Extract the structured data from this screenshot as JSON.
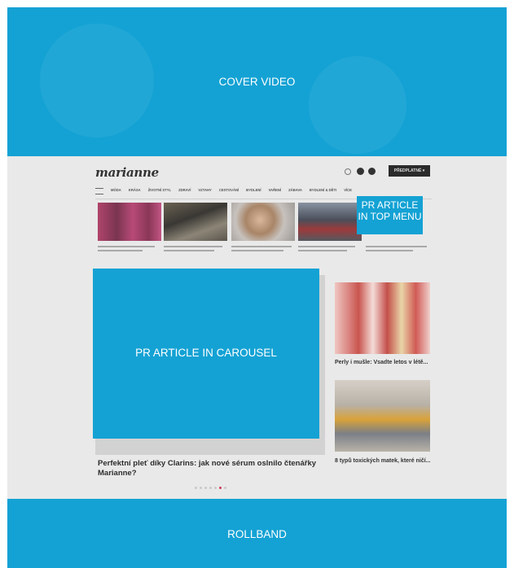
{
  "cover": {
    "label": "COVER VIDEO",
    "color": "#14a2d4"
  },
  "site": {
    "logo": "marianne",
    "subscribe_label": "PŘEDPLATNÉ",
    "nav_items": [
      "MÓDA",
      "KRÁSA",
      "ŽIVOTNÍ STYL",
      "ZDRAVÍ",
      "VZTAHY",
      "CESTOVÁNÍ",
      "BYDLENÍ",
      "VAŘENÍ",
      "ZÁBAVA",
      "BYDLENÍ & DĚTI",
      "VÍCE"
    ],
    "featured_titles": [
      "Perfektní pleť díky Clarins: jak nové sérum oslnilo čtenářky Marianne?"
    ],
    "side_articles": [
      {
        "title": "Perly i mušle: Vsadte letos v létě..."
      },
      {
        "title": "8 typů toxických matek, které ničí..."
      }
    ]
  },
  "overlays": {
    "pr_top_menu": "PR ARTICLE IN TOP MENU",
    "pr_carousel": "PR ARTICLE IN CAROUSEL",
    "rollband": "ROLLBAND"
  },
  "colors": {
    "accent": "#14a2d4",
    "text_on_accent": "#ffffff"
  }
}
